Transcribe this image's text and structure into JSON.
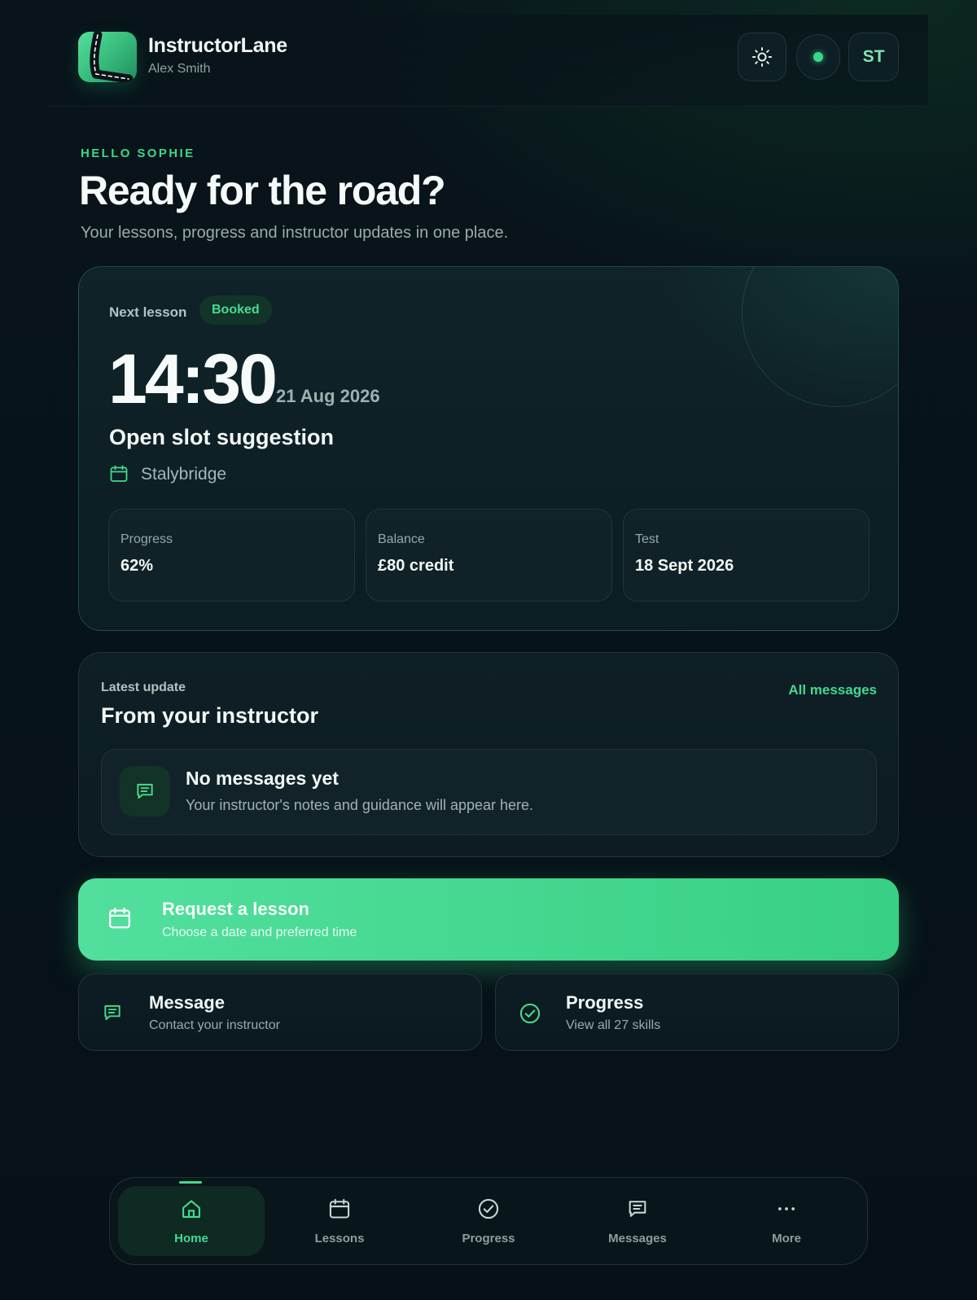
{
  "colors": {
    "accent": "#45d98f",
    "background": "#07131a",
    "card": "#0e1f25",
    "muted_text": "#9aabab"
  },
  "header": {
    "app_name": "InstructorLane",
    "user_name": "Alex Smith",
    "avatar_initials": "ST",
    "theme_icon": "sun-icon",
    "status_icon": "online-dot"
  },
  "hero": {
    "eyebrow": "HELLO SOPHIE",
    "title": "Ready for the road?",
    "subtitle": "Your lessons, progress and instructor updates in one place."
  },
  "next_lesson": {
    "label": "Next lesson",
    "status": "Booked",
    "time": "14:30",
    "date": "21 Aug 2026",
    "title": "Open slot suggestion",
    "location": "Stalybridge",
    "location_icon": "calendar-icon",
    "stats": [
      {
        "label": "Progress",
        "value": "62%"
      },
      {
        "label": "Balance",
        "value": "£80 credit"
      },
      {
        "label": "Test",
        "value": "18 Sept 2026"
      }
    ]
  },
  "latest_update": {
    "label": "Latest update",
    "title": "From your instructor",
    "link_label": "All messages",
    "empty_title": "No messages yet",
    "empty_text": "Your instructor's notes and guidance will appear here.",
    "empty_icon": "message-icon"
  },
  "actions": {
    "request": {
      "title": "Request a lesson",
      "subtitle": "Choose a date and preferred time",
      "icon": "calendar-icon"
    },
    "message": {
      "title": "Message",
      "subtitle": "Contact your instructor",
      "icon": "message-icon"
    },
    "progress": {
      "title": "Progress",
      "subtitle": "View all 27 skills",
      "icon": "check-circle-icon"
    }
  },
  "bottom_nav": {
    "items": [
      {
        "label": "Home",
        "icon": "home-icon",
        "active": true
      },
      {
        "label": "Lessons",
        "icon": "calendar-icon",
        "active": false
      },
      {
        "label": "Progress",
        "icon": "check-circle-icon",
        "active": false
      },
      {
        "label": "Messages",
        "icon": "message-icon",
        "active": false
      },
      {
        "label": "More",
        "icon": "more-dots-icon",
        "active": false
      }
    ]
  }
}
